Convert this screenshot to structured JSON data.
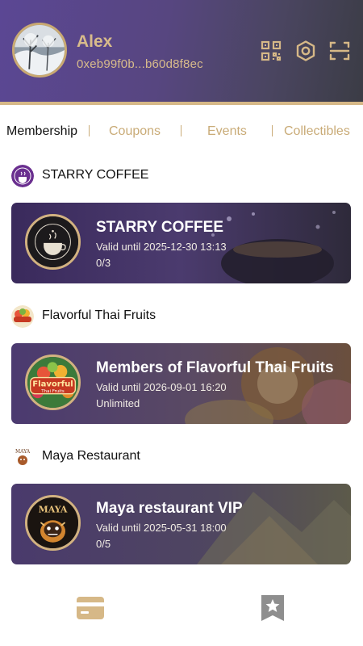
{
  "user": {
    "name": "Alex",
    "wallet": "0xeb99f0b...b60d8f8ec"
  },
  "header_icons": [
    "qr-code-icon",
    "settings-hexagon-icon",
    "scan-icon"
  ],
  "tabs": [
    {
      "label": "Membership",
      "active": true
    },
    {
      "label": "Coupons",
      "active": false
    },
    {
      "label": "Events",
      "active": false
    },
    {
      "label": "Collectibles",
      "active": false
    }
  ],
  "sections": [
    {
      "brand": "STARRY COFFEE",
      "card": {
        "title": "STARRY COFFEE",
        "valid": "Valid until 2025-12-30 13:13",
        "count": "0/3"
      }
    },
    {
      "brand": "Flavorful Thai Fruits",
      "card": {
        "title": "Members of Flavorful Thai Fruits",
        "valid": "Valid until 2026-09-01 16:20",
        "count": "Unlimited"
      },
      "logo_text": {
        "line1": "Flavorful",
        "line2": "Thai Fruits"
      }
    },
    {
      "brand": "Maya Restaurant",
      "card": {
        "title": "Maya restaurant VIP",
        "valid": "Valid until 2025-05-31 18:00",
        "count": "0/5"
      },
      "logo_text": {
        "line1": "MAYA"
      }
    }
  ],
  "bottom_nav": [
    {
      "icon": "wallet-card-icon",
      "active": true
    },
    {
      "icon": "bookmark-star-icon",
      "active": false
    }
  ],
  "colors": {
    "gold": "#d6b887",
    "header_purple": "#574680",
    "inactive_gray": "#8e8e8e"
  }
}
